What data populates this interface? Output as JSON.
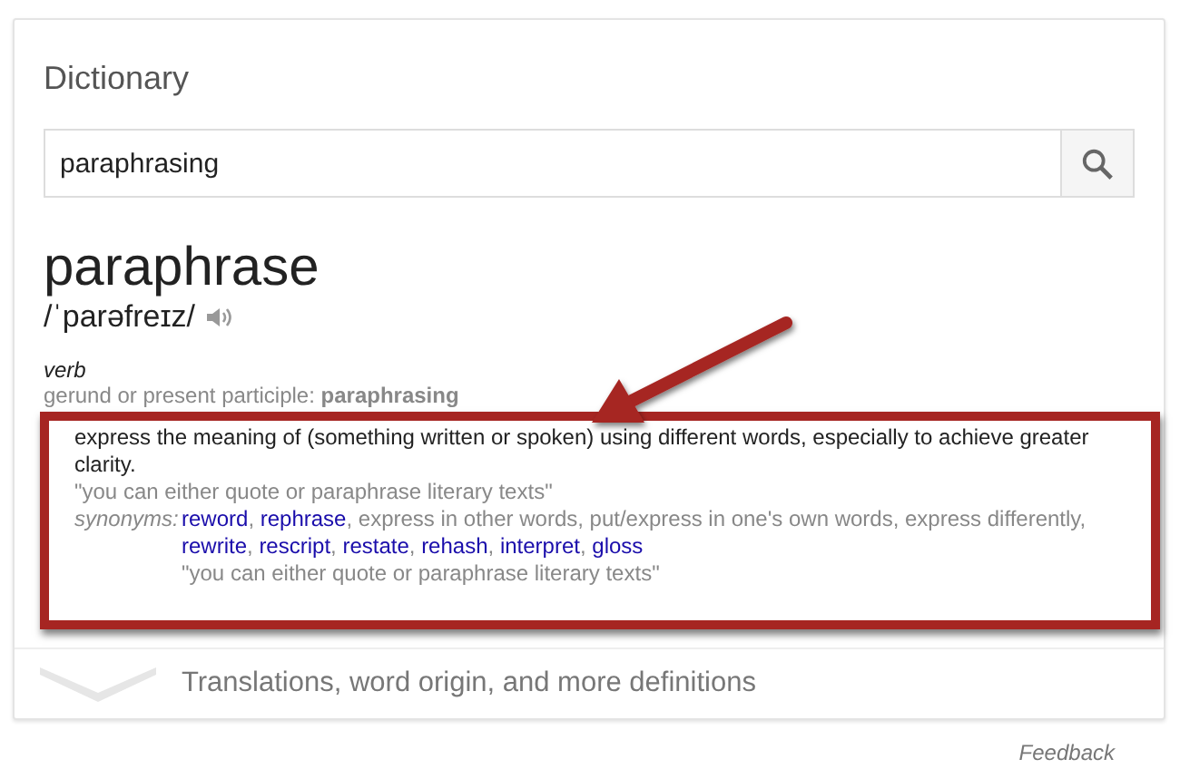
{
  "card": {
    "title": "Dictionary",
    "search": {
      "value": "paraphrasing"
    },
    "headword": "paraphrase",
    "pronunciation": "/ˈparəfreɪz/",
    "part_of_speech": "verb",
    "inflection": {
      "label": "gerund or present participle:",
      "form": "paraphrasing"
    },
    "senses": [
      {
        "definition": "express the meaning of (something written or spoken) using different words, especially to achieve greater clarity.",
        "example": "\"you can either quote or paraphrase literary texts\"",
        "synonyms_label": "synonyms:",
        "synonyms": [
          {
            "text": "reword",
            "kind": "link"
          },
          {
            "text": ", ",
            "kind": "plain"
          },
          {
            "text": "rephrase",
            "kind": "link"
          },
          {
            "text": ", express in other words, put/express in one's own words, express differently, ",
            "kind": "plain"
          },
          {
            "text": "rewrite",
            "kind": "link"
          },
          {
            "text": ", ",
            "kind": "plain"
          },
          {
            "text": "rescript",
            "kind": "link"
          },
          {
            "text": ", ",
            "kind": "plain"
          },
          {
            "text": "restate",
            "kind": "link"
          },
          {
            "text": ", ",
            "kind": "plain"
          },
          {
            "text": "rehash",
            "kind": "link"
          },
          {
            "text": ", ",
            "kind": "plain"
          },
          {
            "text": "interpret",
            "kind": "link"
          },
          {
            "text": ", ",
            "kind": "plain"
          },
          {
            "text": "gloss",
            "kind": "link"
          }
        ],
        "synonym_example": "\"you can either quote or paraphrase literary texts\""
      }
    ],
    "more": "Translations, word origin, and more definitions"
  },
  "feedback": "Feedback"
}
